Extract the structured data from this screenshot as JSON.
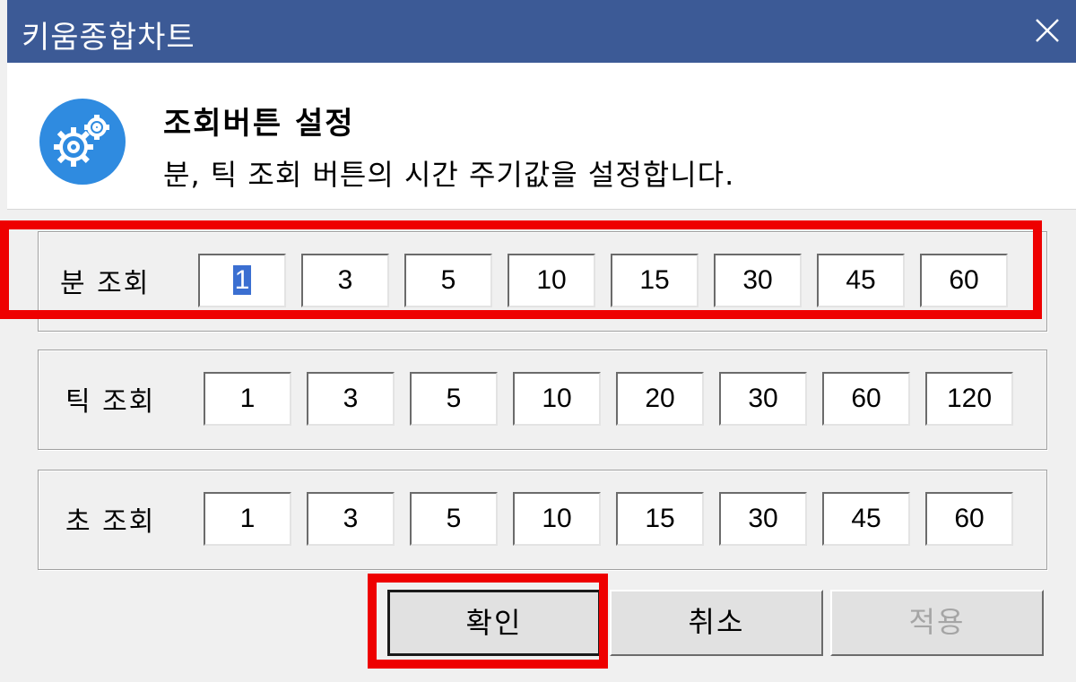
{
  "window": {
    "title": "키움종합차트",
    "close_icon": "close-icon"
  },
  "header": {
    "icon": "gear-icon",
    "icon_color": "#2f8be0",
    "title": "조회버튼 설정",
    "description": "분, 틱 조회 버튼의 시간 주기값을 설정합니다."
  },
  "groups": {
    "minute": {
      "label": "분 조회",
      "values": [
        "1",
        "3",
        "5",
        "10",
        "15",
        "30",
        "45",
        "60"
      ]
    },
    "tick": {
      "label": "틱 조회",
      "values": [
        "1",
        "3",
        "5",
        "10",
        "20",
        "30",
        "60",
        "120"
      ]
    },
    "second": {
      "label": "초 조회",
      "values": [
        "1",
        "3",
        "5",
        "10",
        "15",
        "30",
        "45",
        "60"
      ]
    }
  },
  "buttons": {
    "ok": "확인",
    "cancel": "취소",
    "apply": "적용"
  },
  "colors": {
    "titlebar": "#3c5a96",
    "highlight": "#ee0000",
    "disabled_text": "#a5a5a5"
  }
}
